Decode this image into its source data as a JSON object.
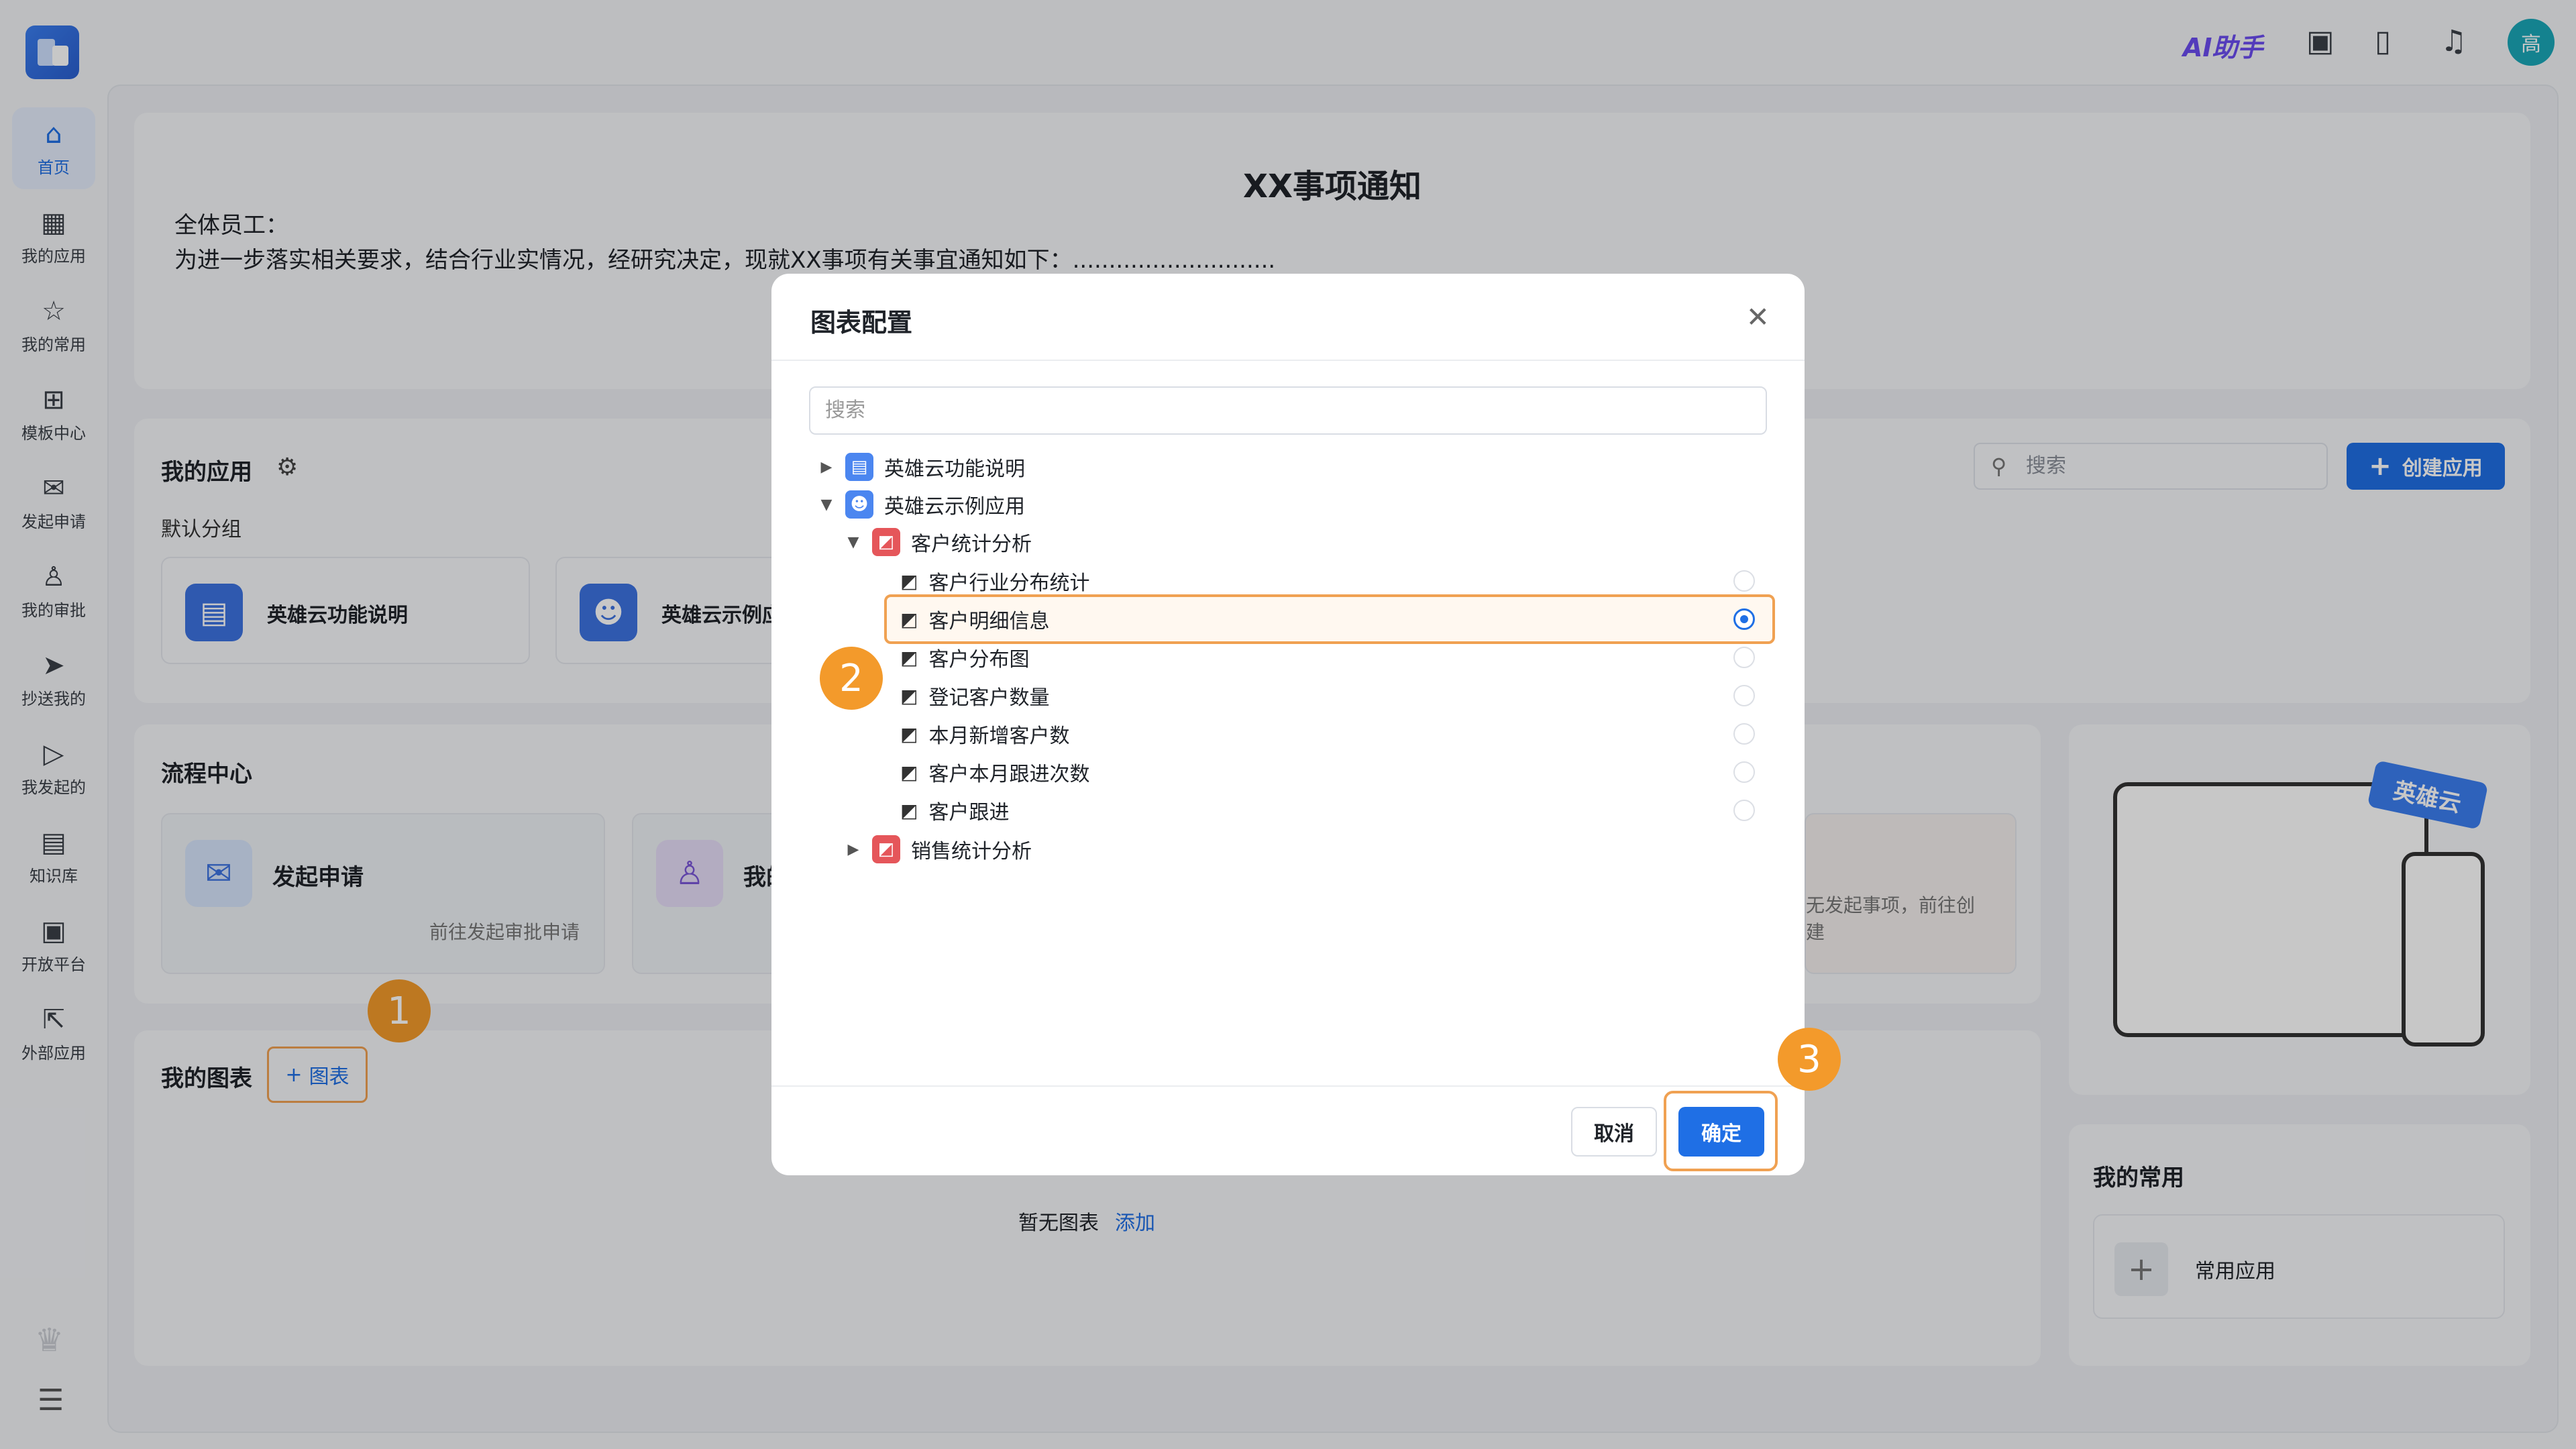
{
  "sidebar": {
    "items": [
      {
        "icon": "home-icon",
        "glyph": "⌂",
        "label": "首页"
      },
      {
        "icon": "apps-icon",
        "glyph": "▦",
        "label": "我的应用"
      },
      {
        "icon": "star-icon",
        "glyph": "☆",
        "label": "我的常用"
      },
      {
        "icon": "template-icon",
        "glyph": "⊞",
        "label": "模板中心"
      },
      {
        "icon": "mail-icon",
        "glyph": "✉",
        "label": "发起申请"
      },
      {
        "icon": "stamp-icon",
        "glyph": "♙",
        "label": "我的审批"
      },
      {
        "icon": "send-icon",
        "glyph": "➤",
        "label": "抄送我的"
      },
      {
        "icon": "play-icon",
        "glyph": "▷",
        "label": "我发起的"
      },
      {
        "icon": "book-icon",
        "glyph": "▤",
        "label": "知识库"
      },
      {
        "icon": "terminal-icon",
        "glyph": "▣",
        "label": "开放平台"
      },
      {
        "icon": "external-link-icon",
        "glyph": "⇱",
        "label": "外部应用"
      }
    ]
  },
  "topbar": {
    "ai_label": "AI助手",
    "avatar_text": "高"
  },
  "notice": {
    "title": "XX事项通知",
    "greeting": "全体员工：",
    "body": "为进一步落实相关要求，结合行业实情况，经研究决定，现就XX事项有关事宜通知如下：............................"
  },
  "my_apps": {
    "title": "我的应用",
    "group": "默认分组",
    "search_placeholder": "搜索",
    "create_label": "创建应用",
    "apps": [
      "英雄云功能说明",
      "英雄云示例应"
    ]
  },
  "flow_center": {
    "title": "流程中心",
    "card1_title": "发起申请",
    "card1_hint": "前往发起审批申请",
    "card2_title": "我的",
    "card3_hint": "无发起事项，前往创建"
  },
  "my_charts": {
    "title": "我的图表",
    "add_label": "图表",
    "empty_text": "暂无图表",
    "empty_link": "添加"
  },
  "promo": {
    "badge": "英雄云"
  },
  "my_common": {
    "title": "我的常用",
    "item_label": "常用应用"
  },
  "dialog": {
    "title": "图表配置",
    "search_placeholder": "搜索",
    "tree": {
      "node1": "英雄云功能说明",
      "node2": "英雄云示例应用",
      "group1": "客户统计分析",
      "leaves": [
        "客户行业分布统计",
        "客户明细信息",
        "客户分布图",
        "登记客户数量",
        "本月新增客户数",
        "客户本月跟进次数",
        "客户跟进"
      ],
      "selected": "客户明细信息",
      "group2": "销售统计分析"
    },
    "cancel_label": "取消",
    "ok_label": "确定"
  },
  "steps": [
    "1",
    "2",
    "3"
  ],
  "colors": {
    "accent": "#1f6fe5",
    "highlight": "#f0a152",
    "step": "#f39a2b"
  }
}
